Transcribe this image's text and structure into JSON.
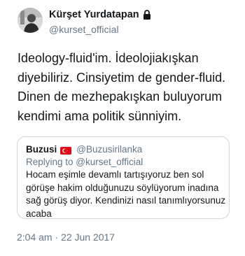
{
  "author": {
    "display_name": "Kürşet Yurdatapan",
    "handle": "@kurset_official",
    "avatar_icon": "profile-photo-icon",
    "protected_icon": "lock-icon"
  },
  "tweet": {
    "lines": [
      "Ideology-fluid'im. İdeolojiakışkan",
      "diyebiliriz. Cinsiyetim de gender-fluid.",
      "Dinen de mezhepakışkan buluyorum",
      "kendimi ama politik sünniyim."
    ]
  },
  "quoted_tweet": {
    "display_name": "Buzusi",
    "flag_icon": "turkey-flag-icon",
    "handle": "@Buzusirilanka",
    "reply_to": "Replying to @kurset_official",
    "lines": [
      "Hocam eşimle devamlı tartışıyoruz ben sol",
      "görüşe hakim olduğunuzu söylüyorum inadına",
      "sağ görüş diyor. Kendinizi nasıl tanımlıyorsunuz",
      "acaba"
    ]
  },
  "timestamp": "2:04 am · 22 Jun 2017",
  "colors": {
    "text": "#14171a",
    "secondary": "#657786",
    "border": "#ccd6dd",
    "flag_red": "#e30a17"
  }
}
